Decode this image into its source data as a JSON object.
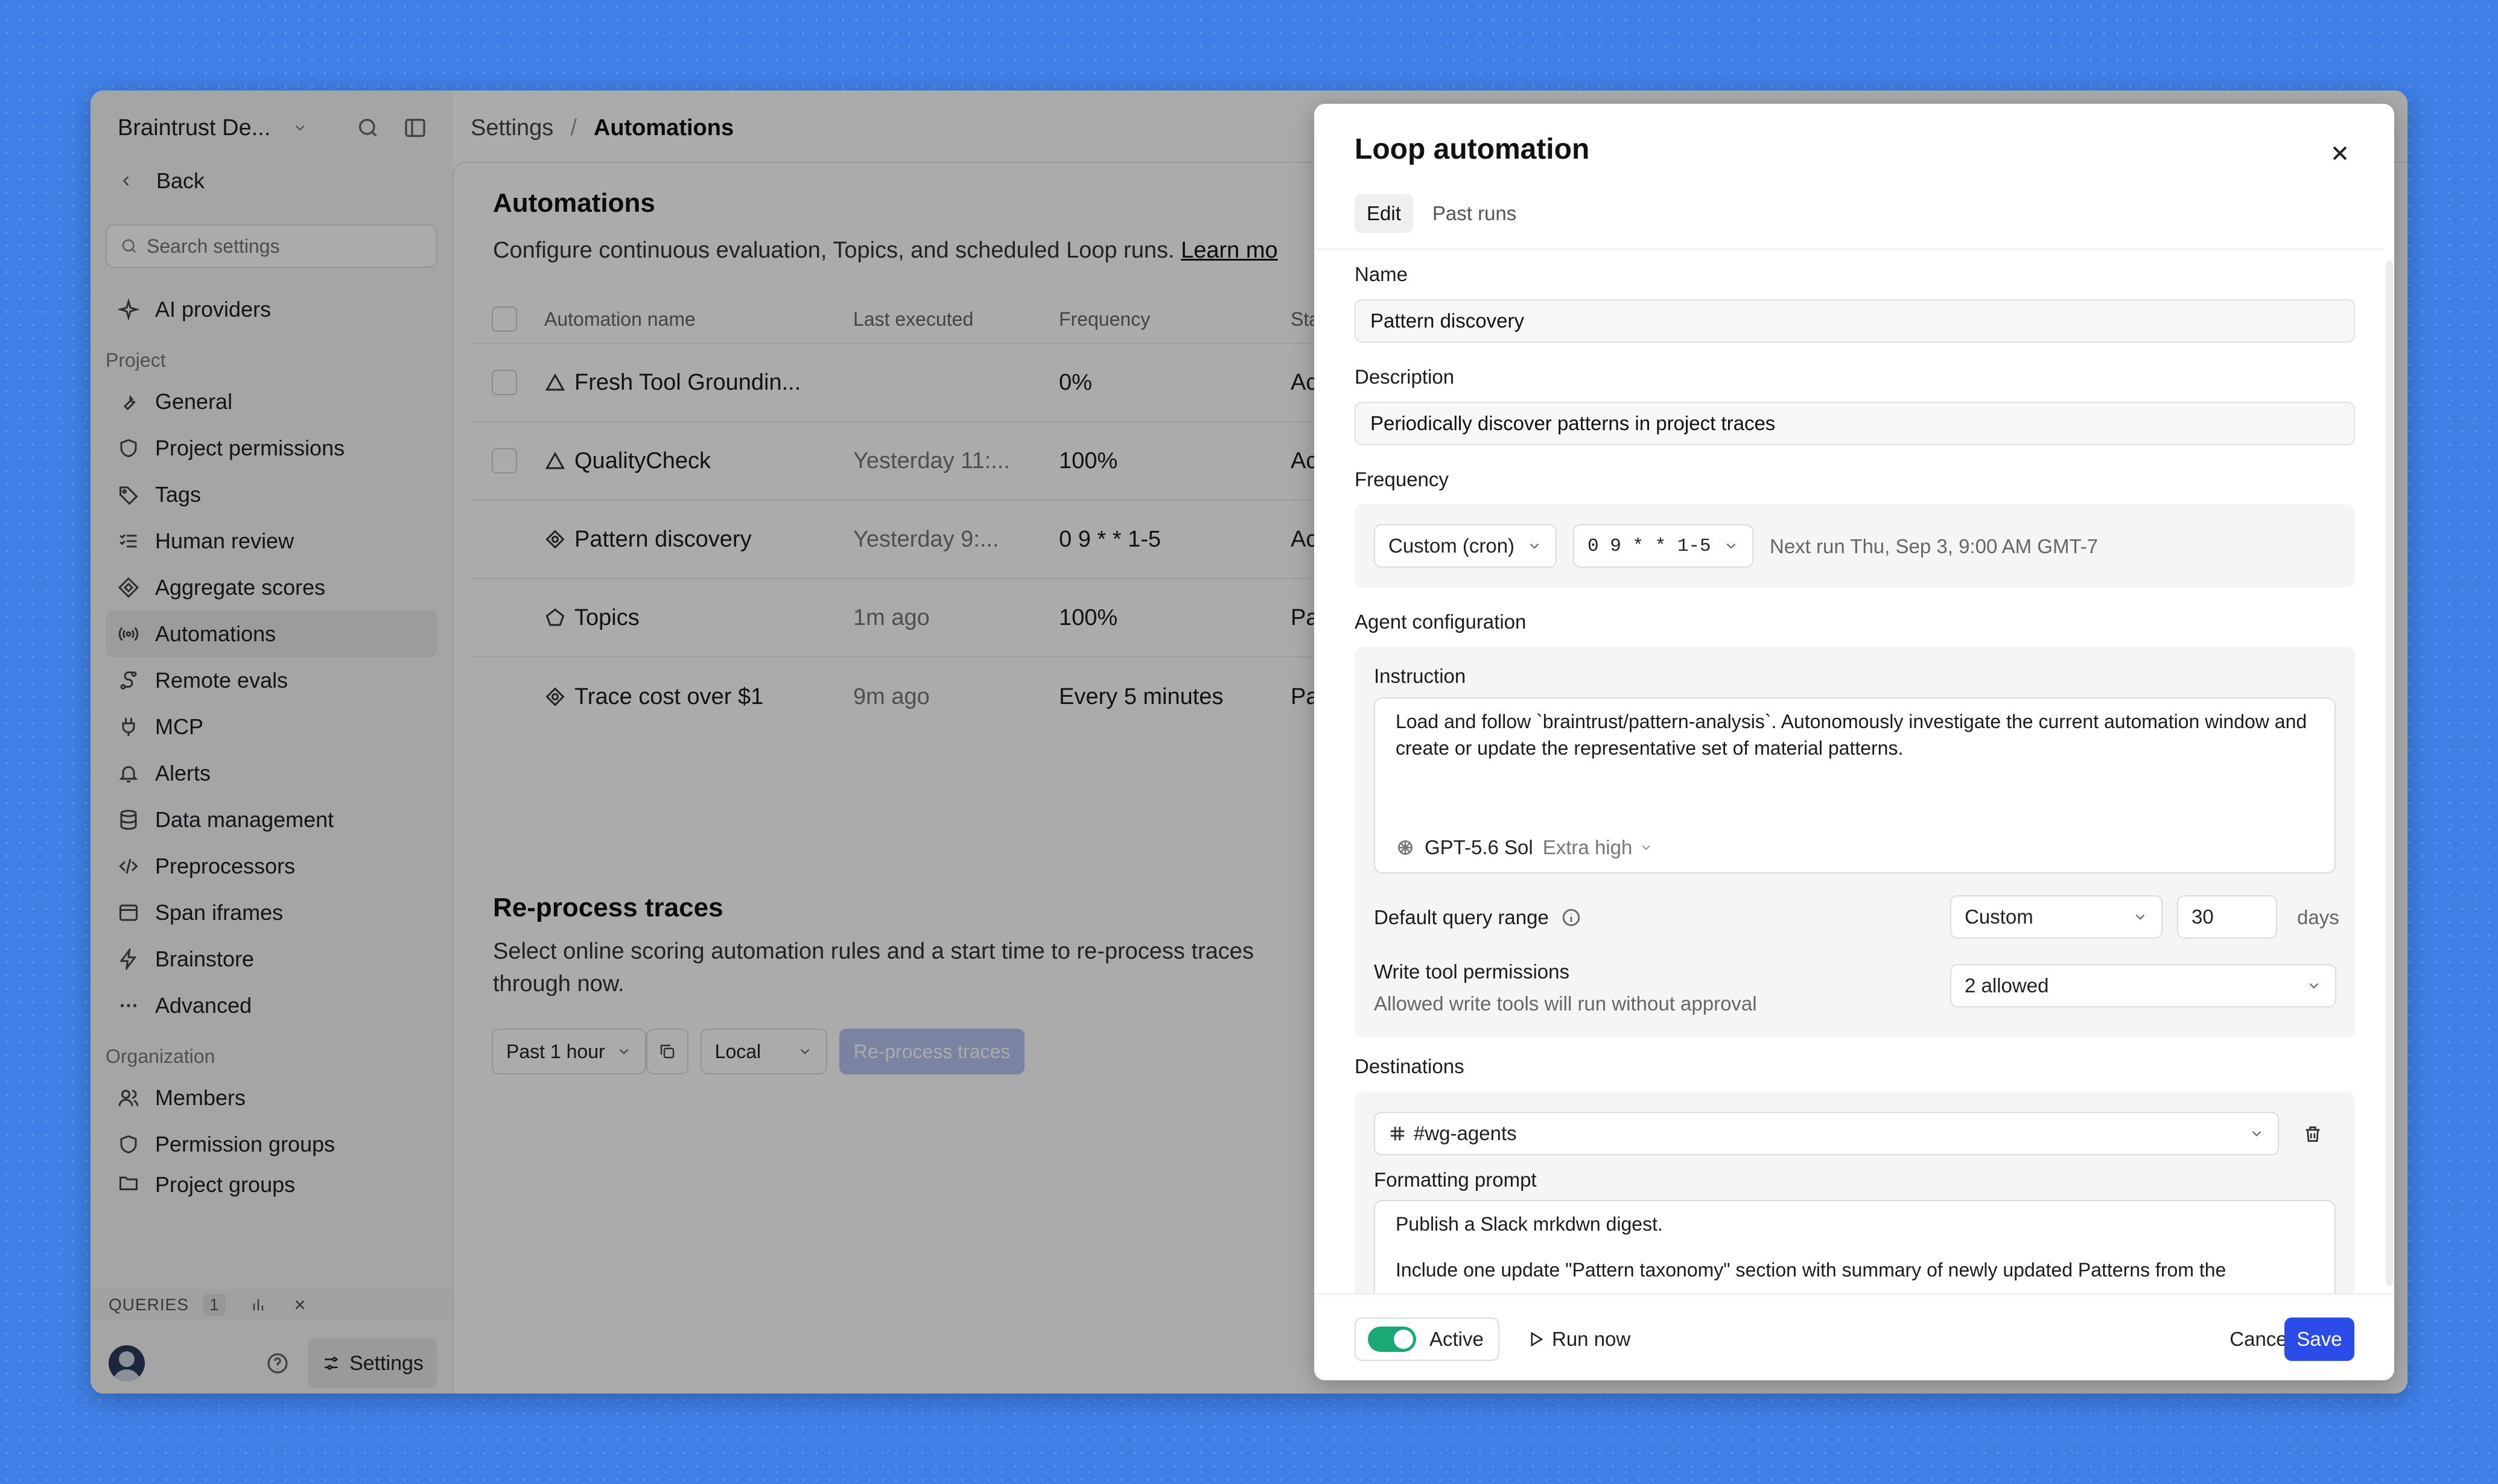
{
  "sidebar": {
    "workspace": "Braintrust De...",
    "back_label": "Back",
    "search_placeholder": "Search settings",
    "top_items": [
      {
        "label": "AI providers",
        "icon": "sparkle-icon"
      }
    ],
    "project_group": "Project",
    "project_items": [
      {
        "label": "General",
        "icon": "wrench-icon"
      },
      {
        "label": "Project permissions",
        "icon": "shield-icon"
      },
      {
        "label": "Tags",
        "icon": "tag-icon"
      },
      {
        "label": "Human review",
        "icon": "list-check-icon"
      },
      {
        "label": "Aggregate scores",
        "icon": "diamond-icon"
      },
      {
        "label": "Automations",
        "icon": "broadcast-icon",
        "active": true
      },
      {
        "label": "Remote evals",
        "icon": "route-icon"
      },
      {
        "label": "MCP",
        "icon": "plug-icon"
      },
      {
        "label": "Alerts",
        "icon": "bell-icon"
      },
      {
        "label": "Data management",
        "icon": "database-icon"
      },
      {
        "label": "Preprocessors",
        "icon": "code-icon"
      },
      {
        "label": "Span iframes",
        "icon": "window-icon"
      },
      {
        "label": "Brainstore",
        "icon": "bolt-icon"
      },
      {
        "label": "Advanced",
        "icon": "more-icon"
      }
    ],
    "org_group": "Organization",
    "org_items": [
      {
        "label": "Members",
        "icon": "users-icon"
      },
      {
        "label": "Permission groups",
        "icon": "shield-icon"
      },
      {
        "label": "Project groups",
        "icon": "folder-icon"
      }
    ],
    "queries_label": "QUERIES",
    "queries_count": "1",
    "settings_label": "Settings"
  },
  "breadcrumb": {
    "parent": "Settings",
    "separator": "/",
    "current": "Automations"
  },
  "automations": {
    "title": "Automations",
    "description": "Configure continuous evaluation, Topics, and scheduled Loop runs.",
    "learn_more": "Learn mo",
    "columns": [
      "Automation name",
      "Last executed",
      "Frequency",
      "Sta"
    ],
    "rows": [
      {
        "name": "Fresh Tool Groundin...",
        "icon": "triangle-icon",
        "last": "",
        "freq": "0%",
        "status": "Ac",
        "checkbox": true
      },
      {
        "name": "QualityCheck",
        "icon": "triangle-icon",
        "last": "Yesterday 11:...",
        "freq": "100%",
        "status": "Ac",
        "checkbox": true
      },
      {
        "name": "Pattern discovery",
        "icon": "loop-icon",
        "last": "Yesterday 9:...",
        "freq": "0 9 * * 1-5",
        "status": "Ac",
        "checkbox": false
      },
      {
        "name": "Topics",
        "icon": "pentagon-icon",
        "last": "1m ago",
        "freq": "100%",
        "status": "Pa",
        "checkbox": false
      },
      {
        "name": "Trace cost over $1",
        "icon": "loop-icon",
        "last": "9m ago",
        "freq": "Every 5 minutes",
        "status": "Pa",
        "checkbox": false
      }
    ]
  },
  "reprocess": {
    "title": "Re-process traces",
    "desc_line1": "Select online scoring automation rules and a start time to re-process traces",
    "desc_line2": "through now.",
    "range": "Past 1 hour",
    "tz": "Local",
    "button": "Re-process traces"
  },
  "modal": {
    "title": "Loop automation",
    "tabs": [
      "Edit",
      "Past runs"
    ],
    "name_label": "Name",
    "name_value": "Pattern discovery",
    "description_label": "Description",
    "description_value": "Periodically discover patterns in project traces",
    "frequency_label": "Frequency",
    "frequency_mode": "Custom (cron)",
    "cron": "0 9 * * 1-5",
    "next_run": "Next run Thu, Sep 3, 9:00 AM GMT-7",
    "agent_label": "Agent configuration",
    "instruction_label": "Instruction",
    "instruction": "Load and follow `braintrust/pattern-analysis`. Autonomously investigate the current automation window and create or update the representative set of material patterns.",
    "model": "GPT-5.6 Sol",
    "effort": "Extra high",
    "query_range_label": "Default query range",
    "query_range_mode": "Custom",
    "query_range_days": "30",
    "days_label": "days",
    "write_tools_label": "Write tool permissions",
    "write_tools_note": "Allowed write tools will run without approval",
    "write_tools_value": "2 allowed",
    "destinations_label": "Destinations",
    "destination_channel": "#wg-agents",
    "formatting_label": "Formatting prompt",
    "formatting_line1": "Publish a Slack mrkdwn digest.",
    "formatting_line2": "Include one update \"Pattern taxonomy\" section with summary of newly updated Patterns from the",
    "active_label": "Active",
    "run_now": "Run now",
    "cancel": "Cancel",
    "save": "Save"
  },
  "colors": {
    "accent": "#2b4ce8",
    "toggle_on": "#19a974",
    "backdrop": "#3f7fe6"
  }
}
